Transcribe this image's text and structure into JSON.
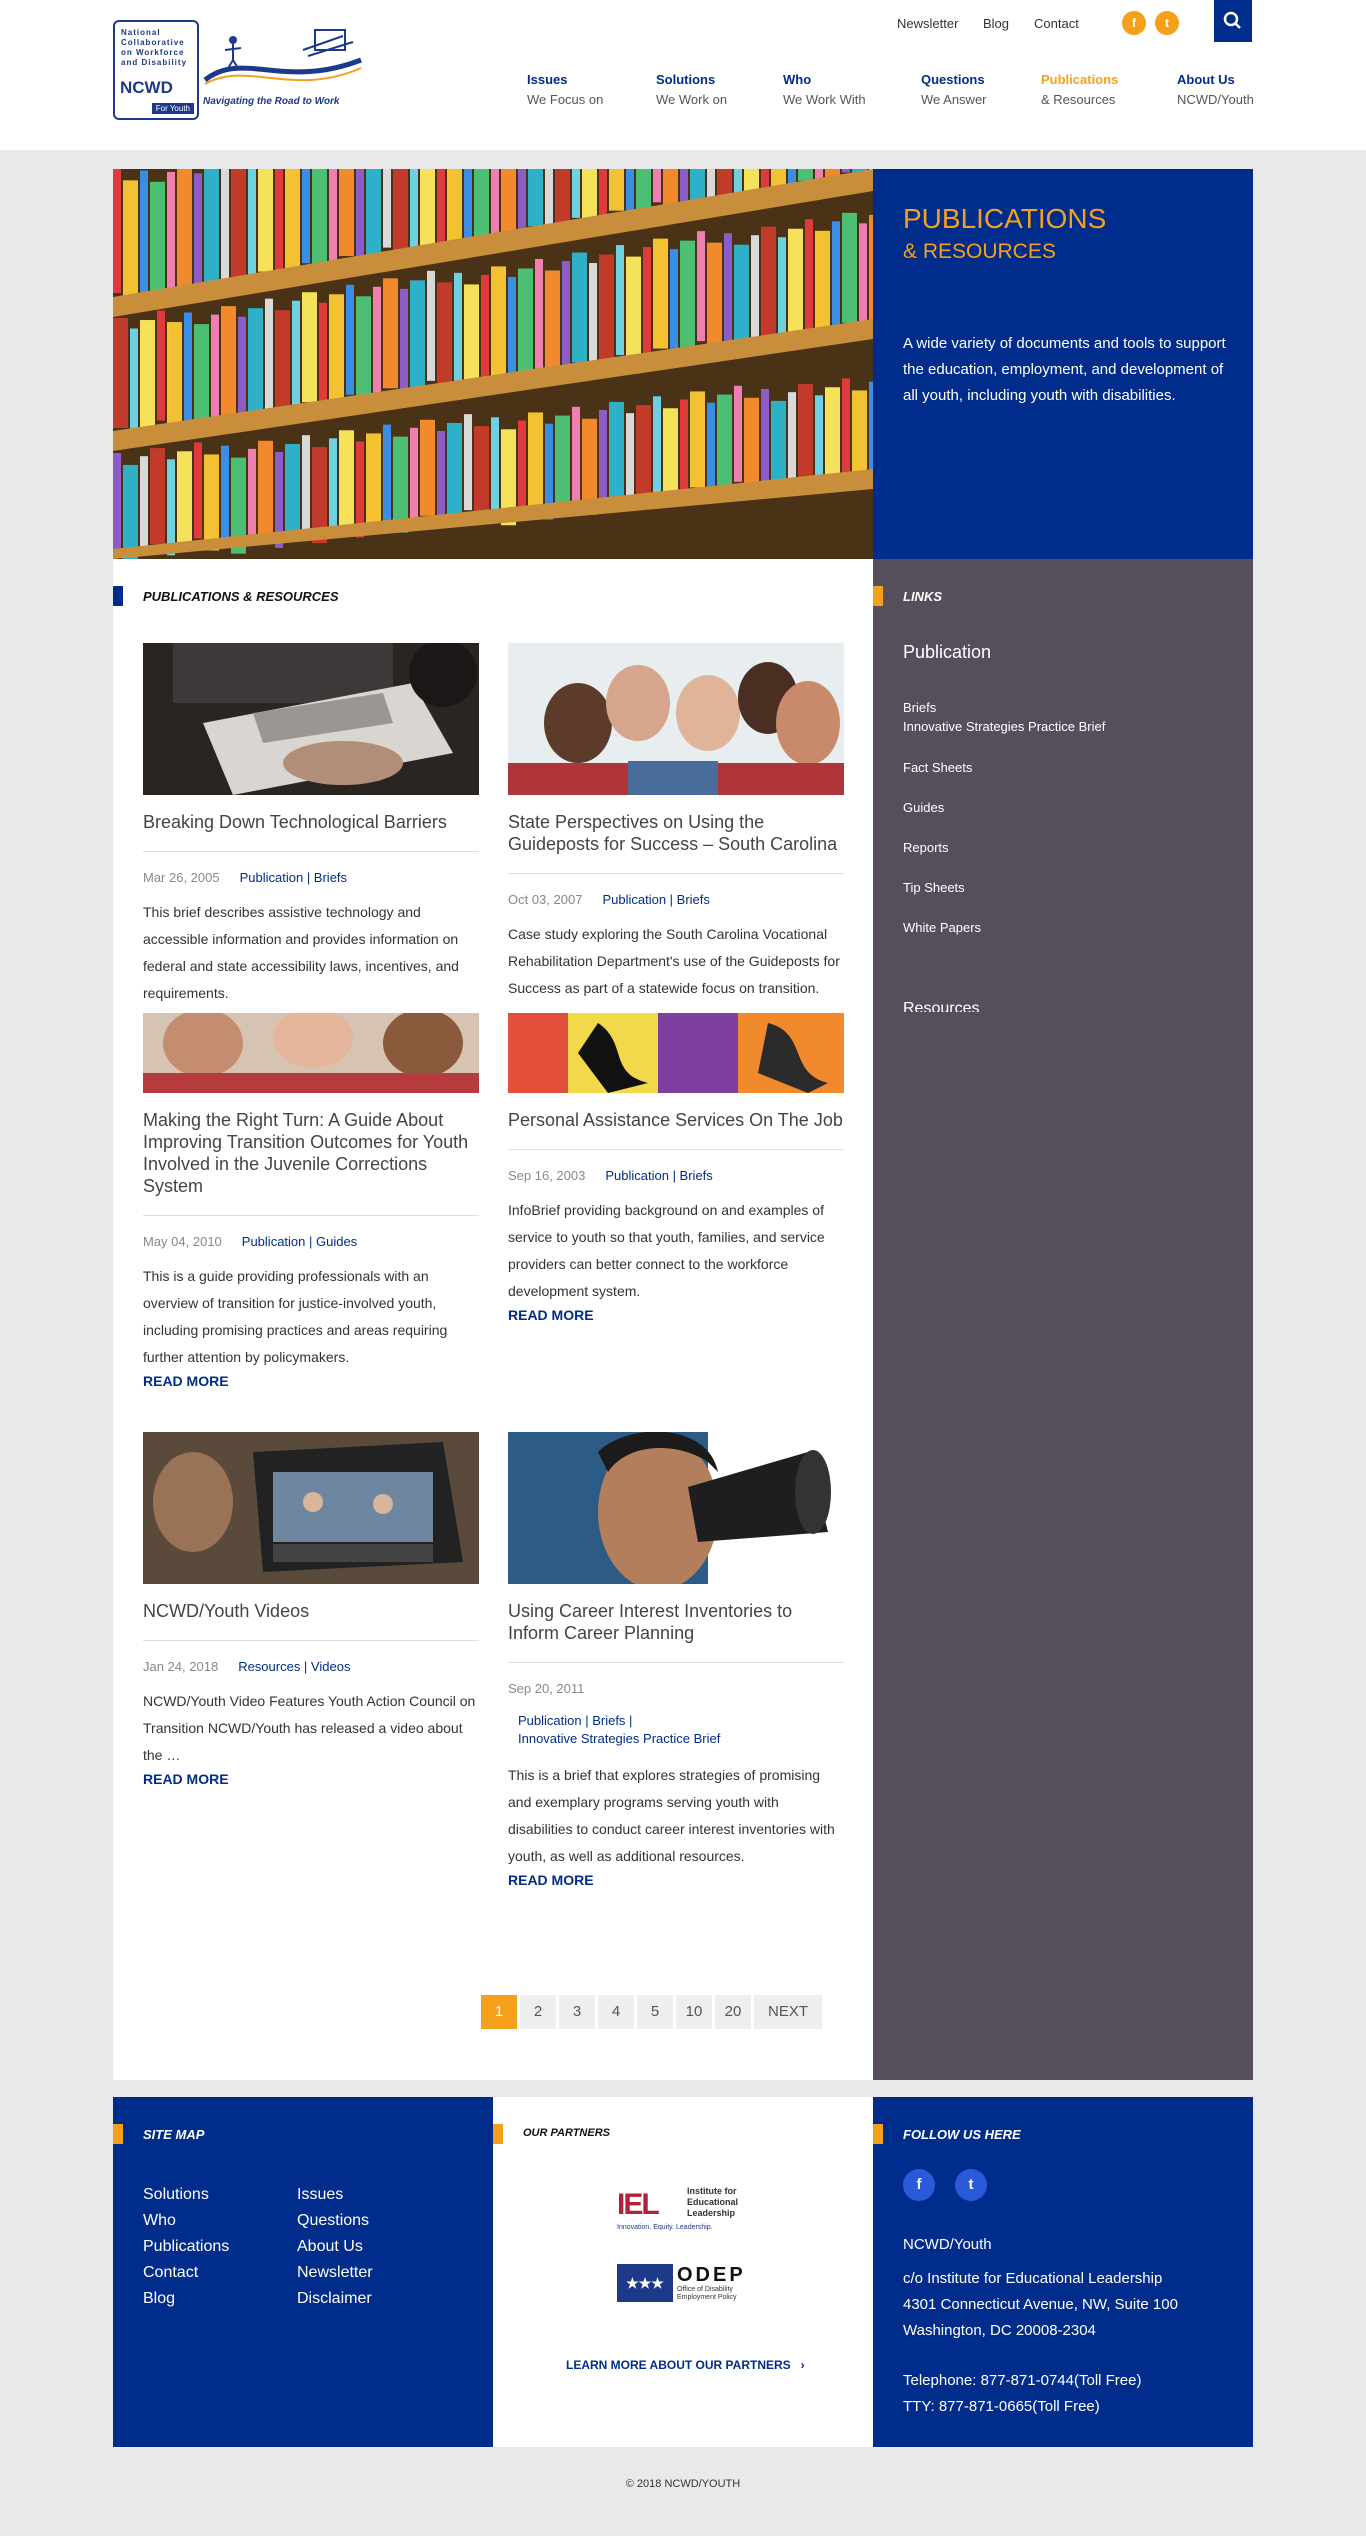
{
  "header": {
    "logo": {
      "small_text": "National Collaborative on Workforce and Disability",
      "ncwd": "NCWD",
      "for_youth": "For Youth",
      "tagline": "Navigating the Road to Work"
    },
    "utility": [
      "Newsletter",
      "Blog",
      "Contact"
    ],
    "social": {
      "facebook": "f",
      "twitter": "t"
    },
    "nav": [
      {
        "top": "Issues",
        "sub": "We Focus on"
      },
      {
        "top": "Solutions",
        "sub": "We Work on"
      },
      {
        "top": "Who",
        "sub": "We Work With"
      },
      {
        "top": "Questions",
        "sub": "We Answer"
      },
      {
        "top": "Publications",
        "sub": "& Resources"
      },
      {
        "top": "About Us",
        "sub": "NCWD/Youth"
      }
    ]
  },
  "hero": {
    "title": "PUBLICATIONS",
    "subtitle": "& RESOURCES",
    "description": "A wide variety of documents and tools to support the education, employment, and development of all youth, including youth with disabilities."
  },
  "main": {
    "section_label": "PUBLICATIONS & RESOURCES",
    "read_more": "READ MORE",
    "cards": [
      {
        "title": "Breaking Down Technological Barriers",
        "date": "Mar 26, 2005",
        "tags": "Publication | Briefs",
        "desc": "This brief describes assistive technology and accessible information and provides information on federal and state accessibility laws, incentives, and requirements."
      },
      {
        "title": "State Perspectives on Using the Guideposts for Success – South Carolina",
        "date": "Oct 03, 2007",
        "tags": "Publication | Briefs",
        "desc": "Case study exploring the South Carolina Vocational Rehabilitation Department's use of the Guideposts for Success as part of a statewide focus on transition."
      },
      {
        "title": "Making the Right Turn: A Guide About Improving Transition Outcomes for Youth Involved in the Juvenile Corrections System",
        "date": "May 04, 2010",
        "tags": "Publication | Guides",
        "desc": "This is a guide providing professionals with an overview of transition for justice-involved youth, including promising practices and areas requiring further attention by policymakers."
      },
      {
        "title": "Personal Assistance Services On The Job",
        "date": "Sep 16, 2003",
        "tags": "Publication | Briefs",
        "desc": "InfoBrief providing background on and examples of service to youth so that youth, families, and service providers can better connect to the workforce development system."
      },
      {
        "title": "NCWD/Youth Videos",
        "date": "Jan 24, 2018",
        "tags": "Resources | Videos",
        "desc": "NCWD/Youth Video Features Youth Action Council on Transition NCWD/Youth has released a video about the …"
      },
      {
        "title": "Using Career Interest Inventories to Inform Career Planning",
        "date": "Sep 20, 2011",
        "tags": "Publication | Briefs |",
        "tags2": "Innovative Strategies Practice Brief",
        "desc": "This is a brief that explores strategies of promising and exemplary programs serving youth with disabilities to conduct career interest inventories with youth, as well as additional resources."
      }
    ],
    "pager": [
      "1",
      "2",
      "3",
      "4",
      "5",
      "10",
      "20",
      "NEXT"
    ]
  },
  "sidebar": {
    "label": "LINKS",
    "heading": "Publication",
    "links": [
      "Briefs",
      "Innovative Strategies Practice Brief",
      "Fact Sheets",
      "Guides",
      "Reports",
      "Tip Sheets",
      "White Papers"
    ],
    "heading2": "Resources"
  },
  "footer": {
    "sitemap_label": "SITE MAP",
    "sitemap_col1": [
      "Solutions",
      "Who",
      "Publications",
      "Contact",
      "Blog"
    ],
    "sitemap_col2": [
      "Issues",
      "Questions",
      "About Us",
      "Newsletter",
      "Disclaimer"
    ],
    "partners_label": "OUR PARTNERS",
    "partner1": {
      "abbr": "IEL",
      "name": "Institute for Educational Leadership",
      "tag": "Innovation. Equity. Leadership."
    },
    "partner2": {
      "abbr": "ODEP",
      "name": "Office of Disability Employment Policy"
    },
    "learn_more": "LEARN MORE ABOUT OUR PARTNERS",
    "follow_label": "FOLLOW US HERE",
    "org": "NCWD/Youth",
    "address": [
      "c/o Institute for Educational Leadership",
      "4301 Connecticut Avenue, NW, Suite 100",
      "Washington, DC 20008-2304"
    ],
    "phone": "Telephone: 877-871-0744(Toll Free)",
    "tty": "TTY: 877-871-0665(Toll Free)",
    "copyright": "© 2018 NCWD/YOUTH"
  },
  "colors": {
    "brand_blue": "#002d8c",
    "accent_orange": "#f5a01a",
    "sidebar_gray": "#564f5b"
  }
}
